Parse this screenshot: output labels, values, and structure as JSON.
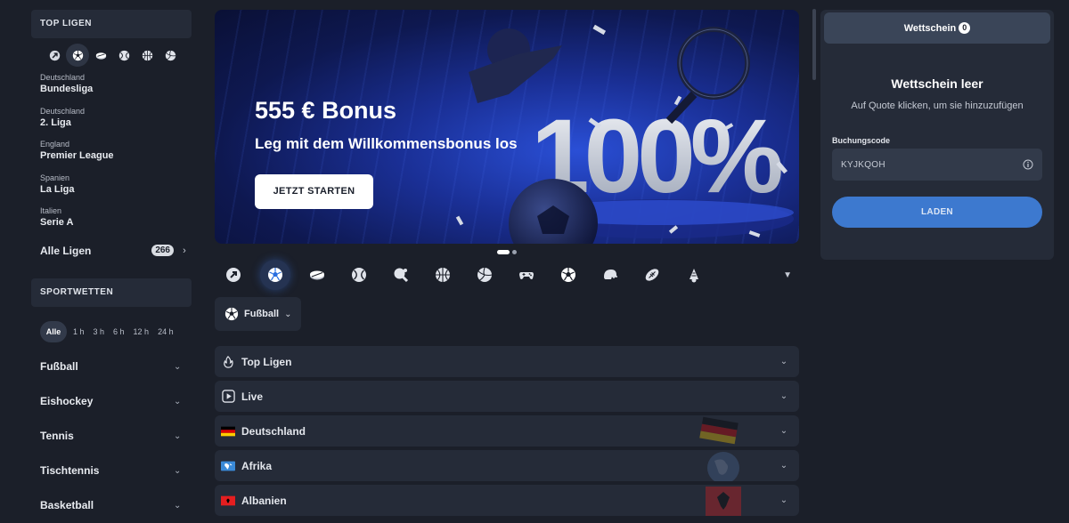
{
  "sidebar": {
    "top_leagues_title": "TOP LIGEN",
    "mini_icons": [
      "trending-icon",
      "football-icon",
      "ice-hockey-icon",
      "tennis-icon",
      "basketball-icon",
      "volleyball-icon"
    ],
    "leagues": [
      {
        "country": "Deutschland",
        "name": "Bundesliga"
      },
      {
        "country": "Deutschland",
        "name": "2. Liga"
      },
      {
        "country": "England",
        "name": "Premier League"
      },
      {
        "country": "Spanien",
        "name": "La Liga"
      },
      {
        "country": "Italien",
        "name": "Serie A"
      }
    ],
    "all_leagues_label": "Alle Ligen",
    "all_leagues_count": "266",
    "sports_betting_title": "SPORTWETTEN",
    "time_filters": [
      "Alle",
      "1 h",
      "3 h",
      "6 h",
      "12 h",
      "24 h"
    ],
    "sports": [
      "Fußball",
      "Eishockey",
      "Tennis",
      "Tischtennis",
      "Basketball"
    ]
  },
  "banner": {
    "title": "555 € Bonus",
    "subtitle": "Leg mit dem Willkommensbonus los",
    "cta": "JETZT STARTEN",
    "art_text": "100%",
    "slides": 2,
    "active_slide": 1
  },
  "sport_icons": [
    "trending-icon",
    "football-icon",
    "ice-hockey-icon",
    "tennis-icon",
    "table-tennis-icon",
    "basketball-icon",
    "volleyball-icon",
    "esports-icon",
    "futsal-icon",
    "american-football-icon",
    "rugby-icon",
    "badminton-icon"
  ],
  "sport_select": {
    "label": "Fußball"
  },
  "accordions": [
    {
      "label": "Top Ligen",
      "icon": "fire-icon"
    },
    {
      "label": "Live",
      "icon": "play-icon"
    },
    {
      "label": "Deutschland",
      "icon": "flag-germany-icon"
    },
    {
      "label": "Afrika",
      "icon": "globe-africa-icon"
    },
    {
      "label": "Albanien",
      "icon": "flag-albania-icon"
    }
  ],
  "betslip": {
    "tab_label": "Wettschein",
    "tab_count": "0",
    "empty_title": "Wettschein leer",
    "empty_subtitle": "Auf Quote klicken, um sie hinzuzufügen",
    "code_label": "Buchungscode",
    "code_value": "KYJKQOH",
    "load_label": "LADEN"
  },
  "colors": {
    "background": "#1b1f29",
    "panel": "#252b38",
    "accent": "#3d79cf"
  }
}
